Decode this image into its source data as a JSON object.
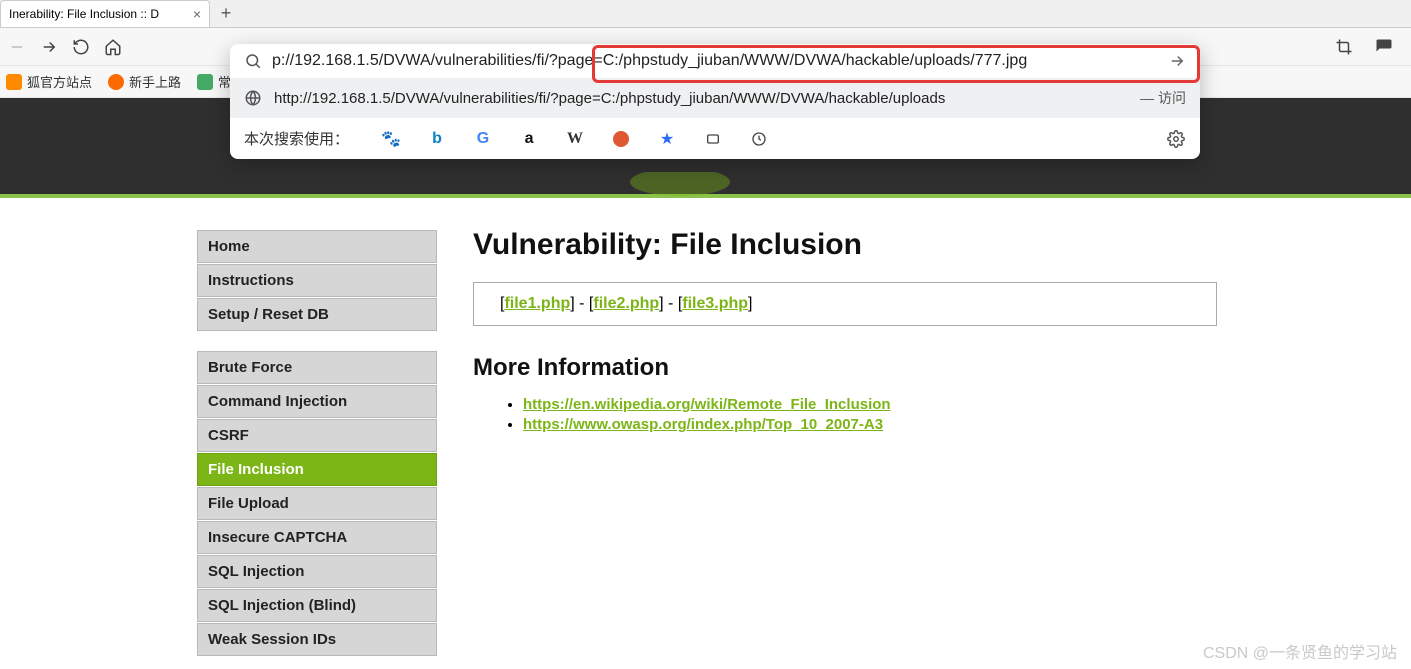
{
  "tab": {
    "title": "Inerability: File Inclusion :: D"
  },
  "url_bar": {
    "visible_url": "p://192.168.1.5/DVWA/vulnerabilities/fi/?page=C:/phpstudy_jiuban/WWW/DVWA/hackable/uploads/777.jpg",
    "suggestion": "http://192.168.1.5/DVWA/vulnerabilities/fi/?page=C:/phpstudy_jiuban/WWW/DVWA/hackable/uploads",
    "suggestion_suffix": "— 访问",
    "engine_label": "本次搜索使用："
  },
  "bookmarks": [
    {
      "label": "狐官方站点",
      "color": "#ff8a00"
    },
    {
      "label": "新手上路",
      "color": "#ff6a00"
    },
    {
      "label": "常",
      "color": "#4a6"
    }
  ],
  "sidebar": {
    "group1": [
      "Home",
      "Instructions",
      "Setup / Reset DB"
    ],
    "group2": [
      "Brute Force",
      "Command Injection",
      "CSRF",
      "File Inclusion",
      "File Upload",
      "Insecure CAPTCHA",
      "SQL Injection",
      "SQL Injection (Blind)",
      "Weak Session IDs"
    ],
    "active": "File Inclusion"
  },
  "main": {
    "heading": "Vulnerability: File Inclusion",
    "files": [
      "file1.php",
      "file2.php",
      "file3.php"
    ],
    "more_heading": "More Information",
    "links": [
      "https://en.wikipedia.org/wiki/Remote_File_Inclusion",
      "https://www.owasp.org/index.php/Top_10_2007-A3"
    ]
  },
  "watermark": "CSDN @一条贤鱼的学习站"
}
